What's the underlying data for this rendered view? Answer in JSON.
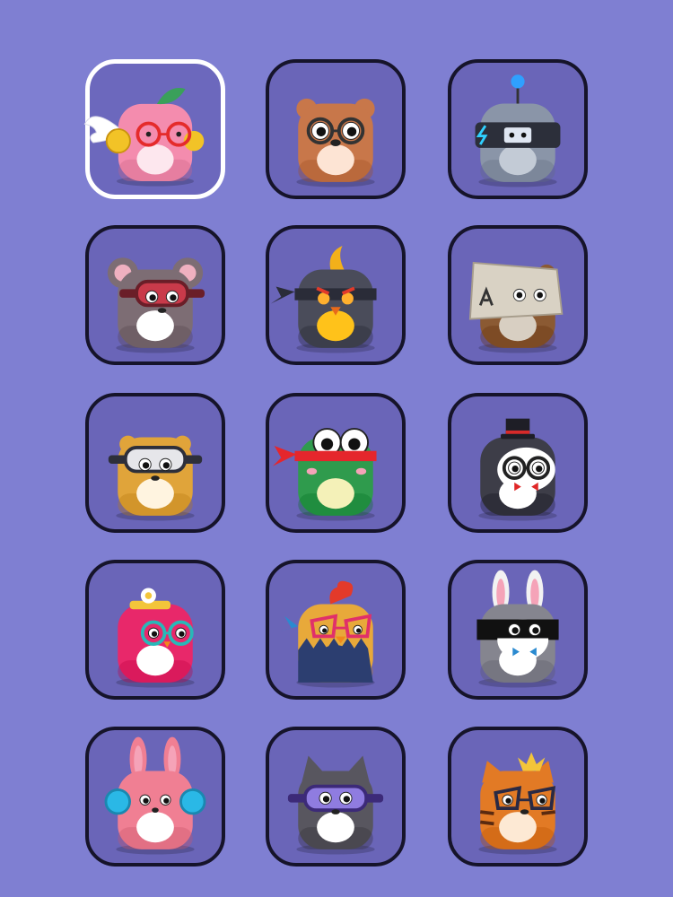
{
  "screen": {
    "background": "#7f7fd2",
    "slot_fill": "#6a65b8",
    "slot_border": "#16142a",
    "selected_border": "#ffffff"
  },
  "avatars": [
    {
      "id": "peach-angel",
      "body": "#f48cae",
      "belly": "#fde7ee",
      "accessory": "wings-halo-glasses",
      "selected": true
    },
    {
      "id": "brown-bear",
      "body": "#c8774a",
      "belly": "#fde4d4",
      "accessory": "round-glasses"
    },
    {
      "id": "robot",
      "body": "#8a95a8",
      "belly": "#c3cbd6",
      "accessory": "antenna-visor"
    },
    {
      "id": "mouse",
      "body": "#7d6d74",
      "belly": "#ffffff",
      "accessory": "goggles"
    },
    {
      "id": "ninja-bird",
      "body": "#4a4c5a",
      "belly": "#ffc21a",
      "accessory": "headband-beak"
    },
    {
      "id": "box-bear",
      "body": "#8b5a33",
      "belly": "#d8cfc2",
      "accessory": "cardboard-box"
    },
    {
      "id": "hamster",
      "body": "#e0a43a",
      "belly": "#fff4e0",
      "accessory": "goggles"
    },
    {
      "id": "frog",
      "body": "#2f9b4d",
      "belly": "#f4f1b8",
      "accessory": "bandana"
    },
    {
      "id": "penguin",
      "body": "#3d3d48",
      "belly": "#ffffff",
      "accessory": "top-hat-bowtie"
    },
    {
      "id": "pink-bird",
      "body": "#e8286a",
      "belly": "#ffffff",
      "accessory": "flower-hat-glasses"
    },
    {
      "id": "rooster",
      "body": "#e8a93a",
      "belly": "#2c3e70",
      "accessory": "comb-glasses"
    },
    {
      "id": "bunny-mask",
      "body": "#85858f",
      "belly": "#ffffff",
      "accessory": "eye-mask"
    },
    {
      "id": "pink-bunny",
      "body": "#f07f93",
      "belly": "#ffffff",
      "accessory": "earmuffs"
    },
    {
      "id": "gray-cat",
      "body": "#58565f",
      "belly": "#ffffff",
      "accessory": "goggles"
    },
    {
      "id": "king-tiger",
      "body": "#e27a25",
      "belly": "#fde9d4",
      "accessory": "crown-glasses"
    }
  ]
}
